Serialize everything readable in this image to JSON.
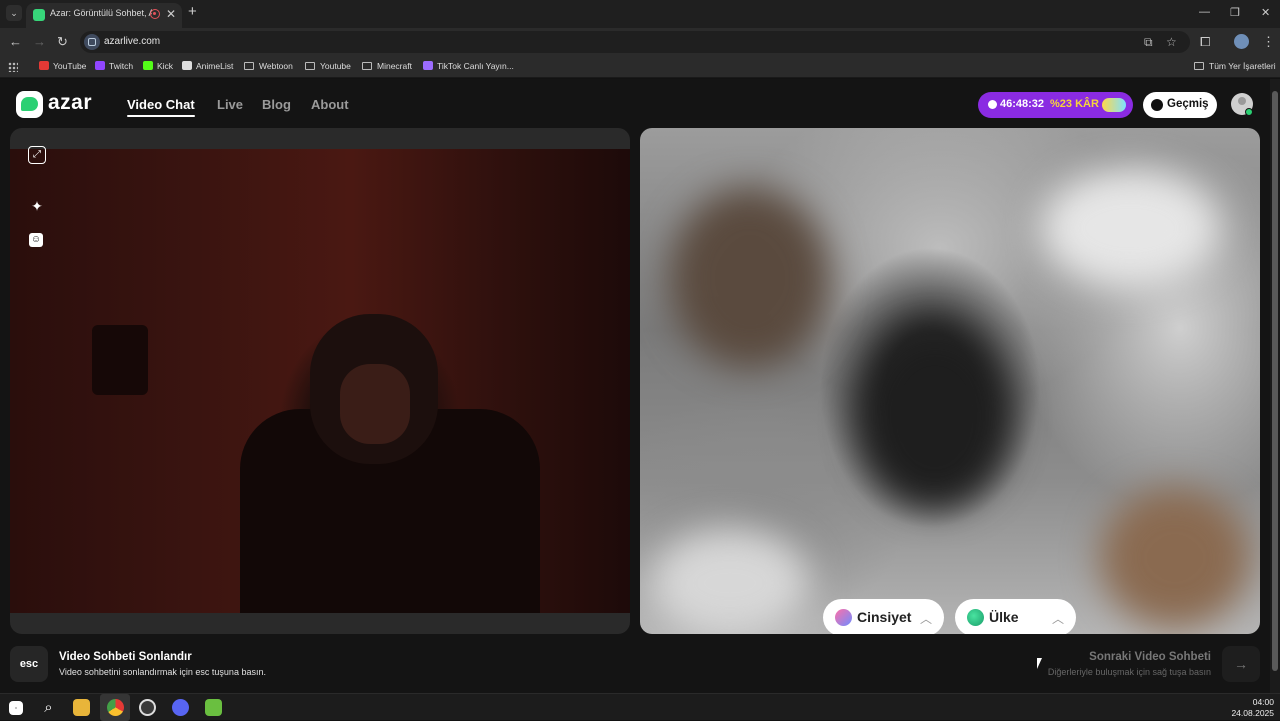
{
  "browser": {
    "tab_title": "Azar: Görüntülü Sohbet, Arkadaş",
    "tab_close": "✕",
    "new_tab": "+",
    "url": "azarlive.com",
    "window_controls": {
      "minimize": "—",
      "restore": "❐",
      "close": "✕"
    },
    "bookmarks": [
      {
        "label": "YouTube",
        "color": "#e53935"
      },
      {
        "label": "Twitch",
        "color": "#9146ff"
      },
      {
        "label": "Kick",
        "color": "#53fc18"
      },
      {
        "label": "AnimeList",
        "color": "#dddddd"
      },
      {
        "label": "Webtoon",
        "folder": true
      },
      {
        "label": "Youtube",
        "folder": true
      },
      {
        "label": "Minecraft",
        "folder": true
      },
      {
        "label": "TikTok Canlı Yayın...",
        "color": "#9c6cff"
      }
    ],
    "all_bookmarks": "Tüm Yer İşaretleri"
  },
  "header": {
    "logo": "azar",
    "nav": [
      "Video Chat",
      "Live",
      "Blog",
      "About"
    ],
    "promo": {
      "timer": "46:48:32",
      "discount": "%23 KÂR"
    },
    "history_label": "Geçmiş"
  },
  "filters": {
    "gender": "Cinsiyet",
    "country": "Ülke"
  },
  "footer": {
    "end_key": "esc",
    "end_title": "Video Sohbeti Sonlandır",
    "end_sub": "Video sohbetini sonlandırmak için esc tuşuna basın.",
    "next_title": "Sonraki Video Sohbeti",
    "next_sub": "Diğerleriyle buluşmak için sağ tuşa basın",
    "next_arrow": "→"
  },
  "taskbar": {
    "time": "04:00",
    "date": "24.08.2025"
  },
  "colors": {
    "accent_green": "#2bd073",
    "promo_purple": "#8a2be2",
    "promo_yellow": "#f7d43a"
  }
}
